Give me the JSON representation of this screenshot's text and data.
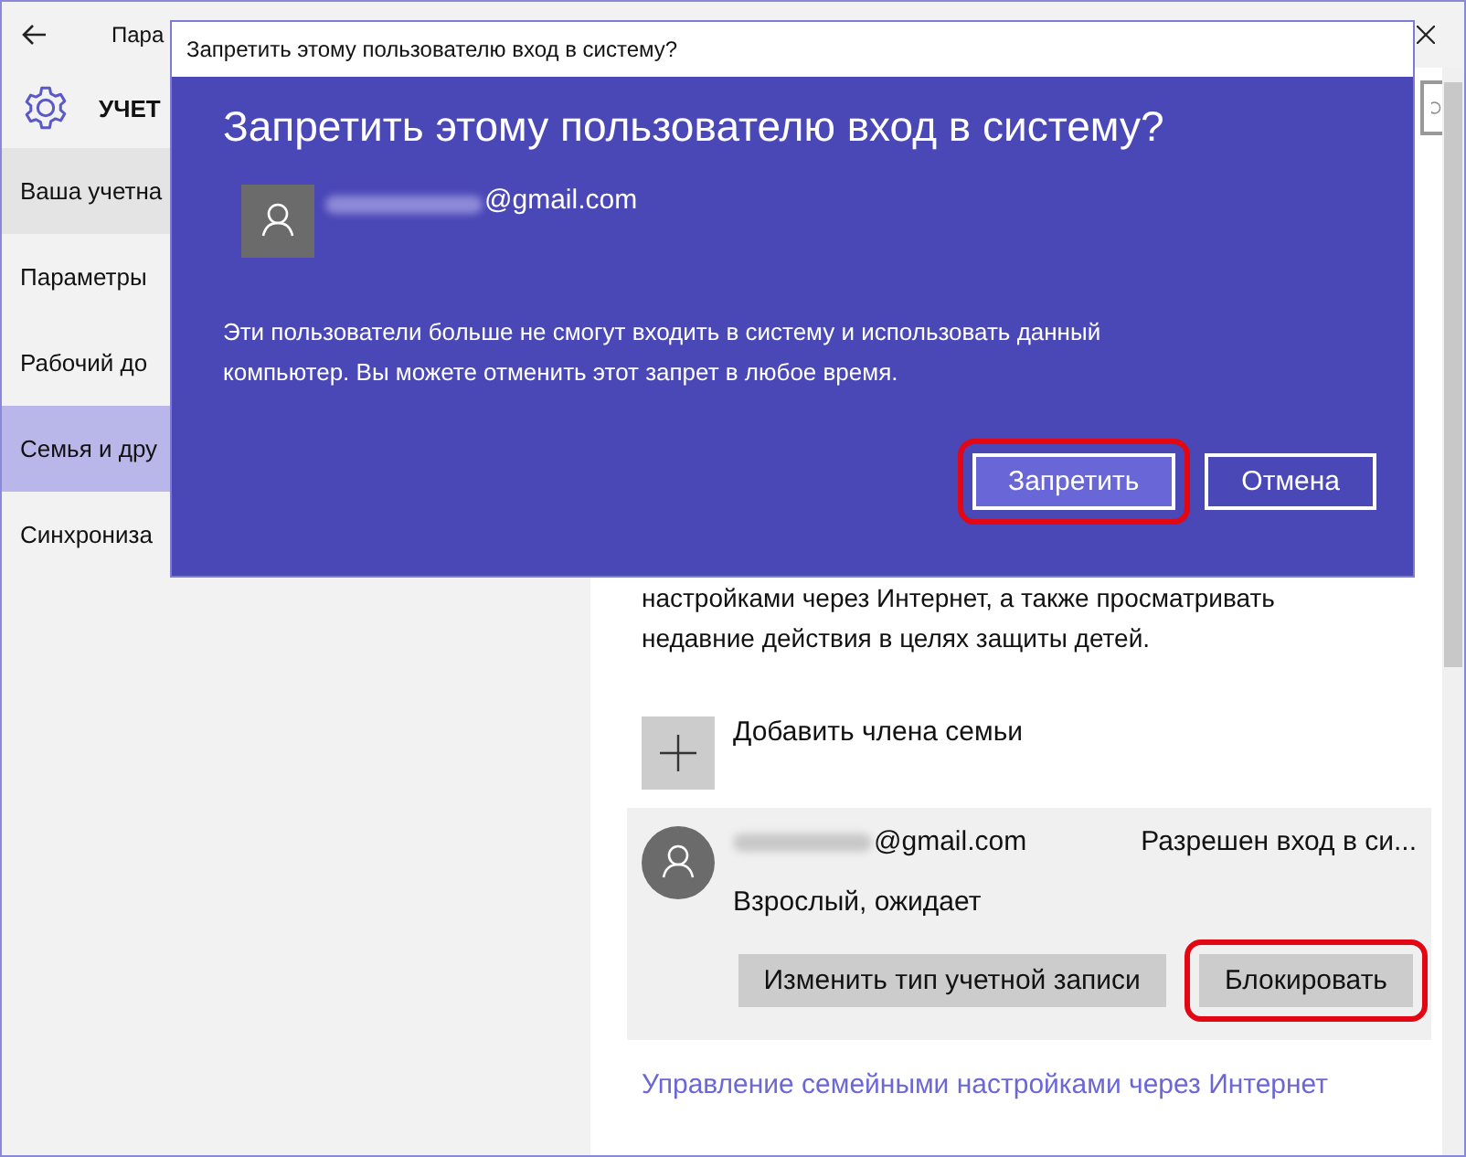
{
  "window": {
    "title": "Пара"
  },
  "header": {
    "title": "УЧЕТ"
  },
  "sidebar": {
    "items": [
      {
        "label": "Ваша учетна",
        "selected": false,
        "hovered": true
      },
      {
        "label": "Параметры",
        "selected": false,
        "hovered": false
      },
      {
        "label": "Рабочий до",
        "selected": false,
        "hovered": false
      },
      {
        "label": "Семья и дру",
        "selected": true,
        "hovered": false
      },
      {
        "label": "Синхрониза",
        "selected": false,
        "hovered": false
      }
    ]
  },
  "content": {
    "description_lines": [
      "настройками через Интернет, а также просматривать",
      "недавние действия в целях защиты детей."
    ],
    "add_member": {
      "label": "Добавить члена семьи"
    },
    "member": {
      "email": "@gmail.com",
      "email_redacted": true,
      "status": "Разрешен вход в си...",
      "role": "Взрослый, ожидает",
      "buttons": [
        {
          "label": "Изменить тип учетной записи",
          "highlighted": false
        },
        {
          "label": "Блокировать",
          "highlighted": true
        }
      ]
    },
    "link": "Управление семейными настройками через Интернет"
  },
  "dialog": {
    "title": "Запретить этому пользователю вход в систему?",
    "heading": "Запретить этому пользователю вход в систему?",
    "email": "@gmail.com",
    "email_redacted": true,
    "message": "Эти пользователи больше не смогут входить в систему и использовать данный компьютер. Вы можете отменить этот запрет в любое время.",
    "buttons": [
      {
        "label": "Запретить",
        "kind": "primary",
        "highlighted": true
      },
      {
        "label": "Отмена",
        "kind": "secondary",
        "highlighted": false
      }
    ]
  }
}
